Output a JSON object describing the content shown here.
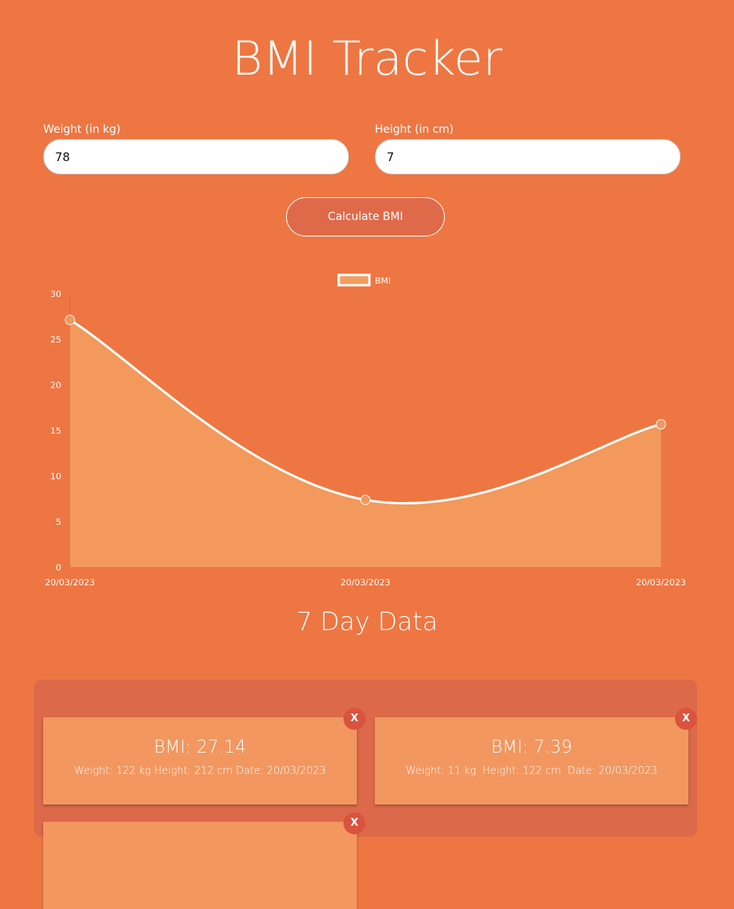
{
  "title": "BMI Tracker",
  "form": {
    "weight_label": "Weight (in kg)",
    "weight_value": "78",
    "height_label": "Height (in cm)",
    "height_value": "7",
    "calculate_label": "Calculate BMI"
  },
  "chart_data": {
    "type": "area",
    "categories": [
      "20/03/2023",
      "20/03/2023",
      "20/03/2023"
    ],
    "series": [
      {
        "name": "BMI",
        "values": [
          27.14,
          7.39,
          15.69
        ]
      }
    ],
    "ylim": [
      0,
      30
    ],
    "yticks": [
      0,
      5,
      10,
      15,
      20,
      25,
      30
    ],
    "legend": "top",
    "grid": false,
    "colors": {
      "fill": "#F29D5E",
      "line": "#FFFFFF"
    }
  },
  "section_title": "7 Day Data",
  "entries": [
    {
      "bmi": "BMI: 27.14",
      "info": "Weight: 122 kg Height: 212 cm Date: 20/03/2023",
      "delete": "X"
    },
    {
      "bmi": "BMI: 7.39",
      "info": "Weight: 11 kg  Height: 122 cm  Date: 20/03/2023",
      "delete": "X"
    },
    {
      "delete": "X"
    }
  ]
}
